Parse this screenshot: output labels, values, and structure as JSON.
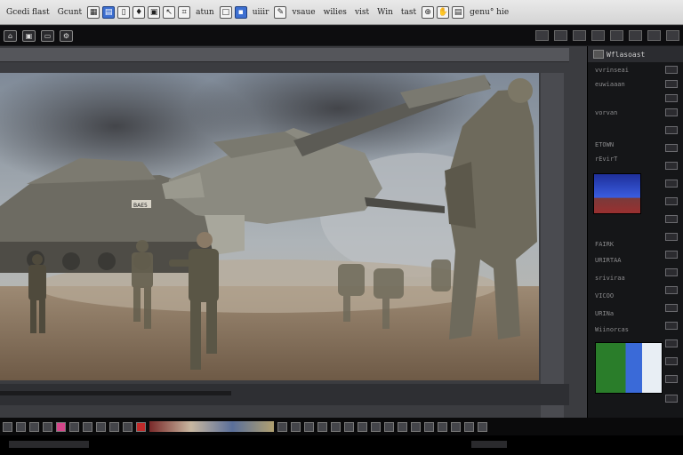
{
  "menubar": {
    "items": [
      "Gcedi flast",
      "Gcunt",
      "atun",
      "uiiir",
      "vsaue",
      "wilies",
      "vist",
      "Win",
      "tast"
    ],
    "right_item": "genu° hie"
  },
  "panel": {
    "header_title": "Wflasoast",
    "layer_labels": [
      "vvrinseai",
      "euwiaaan",
      "vorvan",
      "ETOWN",
      "URIRTAA",
      "rEvirT",
      "FAIRK",
      "VICOO",
      "sriviraa",
      "URINa",
      "Wiinorcas"
    ]
  },
  "canvas": {
    "tank_marking": "BAE5"
  },
  "colors": {
    "menubar_bg": "#e0e0e0",
    "workspace_bg": "#3b3c40",
    "panel_bg": "#151618",
    "accent_blue": "#3d6fd1"
  }
}
